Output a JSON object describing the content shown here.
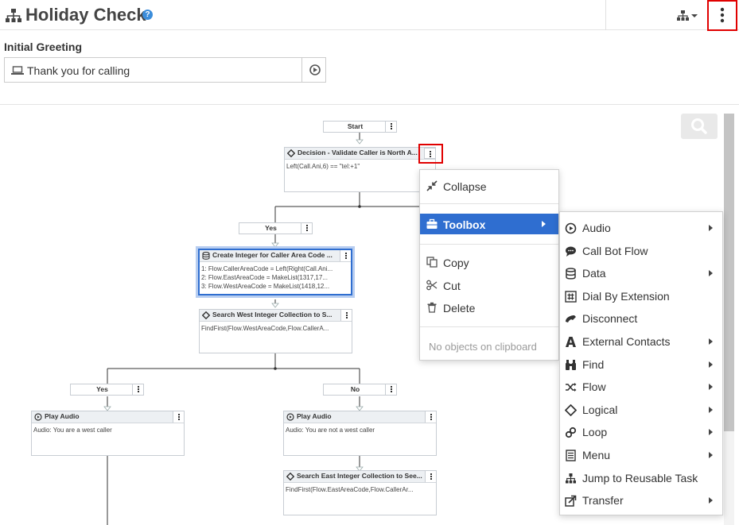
{
  "header": {
    "title": "Holiday Check",
    "help": "?"
  },
  "greeting": {
    "label": "Initial Greeting",
    "value": "Thank you for calling"
  },
  "flow": {
    "start": "Start",
    "decision": {
      "title": "Decision - Validate Caller is North A...",
      "expr": "Left(Call.Ani,6) == \"tel:+1\""
    },
    "yes_top": "Yes",
    "create": {
      "title": "Create Integer for Caller Area Code ...",
      "lines": [
        "1: Flow.CallerAreaCode = Left(Right(Call.Ani...",
        "2: Flow.EastAreaCode = MakeList(1317,17...",
        "3: Flow.WestAreaCode = MakeList(1418,12..."
      ]
    },
    "search_west": {
      "title": "Search West Integer Collection to S...",
      "expr": "FindFirst(Flow.WestAreaCode,Flow.CallerA..."
    },
    "yes_left": "Yes",
    "no_right": "No",
    "play_west": {
      "title": "Play Audio",
      "audio": "Audio: You are a west caller"
    },
    "play_notwest": {
      "title": "Play Audio",
      "audio": "Audio: You are not a west caller"
    },
    "search_east": {
      "title": "Search East Integer Collection to See...",
      "expr": "FindFirst(Flow.EastAreaCode,Flow.CallerAr..."
    }
  },
  "context_menu": {
    "collapse": "Collapse",
    "toolbox": "Toolbox",
    "copy": "Copy",
    "cut": "Cut",
    "delete": "Delete",
    "clipboard_note": "No objects on clipboard"
  },
  "toolbox_menu": [
    {
      "label": "Audio",
      "icon": "play-circle-icon",
      "submenu": true
    },
    {
      "label": "Call Bot Flow",
      "icon": "chat-bubble-icon",
      "submenu": false
    },
    {
      "label": "Data",
      "icon": "database-icon",
      "submenu": true
    },
    {
      "label": "Dial By Extension",
      "icon": "hash-icon",
      "submenu": false
    },
    {
      "label": "Disconnect",
      "icon": "disconnect-icon",
      "submenu": false
    },
    {
      "label": "External Contacts",
      "icon": "contacts-icon",
      "submenu": true
    },
    {
      "label": "Find",
      "icon": "binoculars-icon",
      "submenu": true
    },
    {
      "label": "Flow",
      "icon": "shuffle-icon",
      "submenu": true
    },
    {
      "label": "Logical",
      "icon": "diamond-icon",
      "submenu": true
    },
    {
      "label": "Loop",
      "icon": "loop-icon",
      "submenu": true
    },
    {
      "label": "Menu",
      "icon": "menu-list-icon",
      "submenu": true
    },
    {
      "label": "Jump to Reusable Task",
      "icon": "sitemap-icon",
      "submenu": false
    },
    {
      "label": "Transfer",
      "icon": "transfer-icon",
      "submenu": true
    }
  ],
  "colors": {
    "accent": "#2f6ed0",
    "highlight": "#e00000",
    "help": "#3b8ddb"
  }
}
